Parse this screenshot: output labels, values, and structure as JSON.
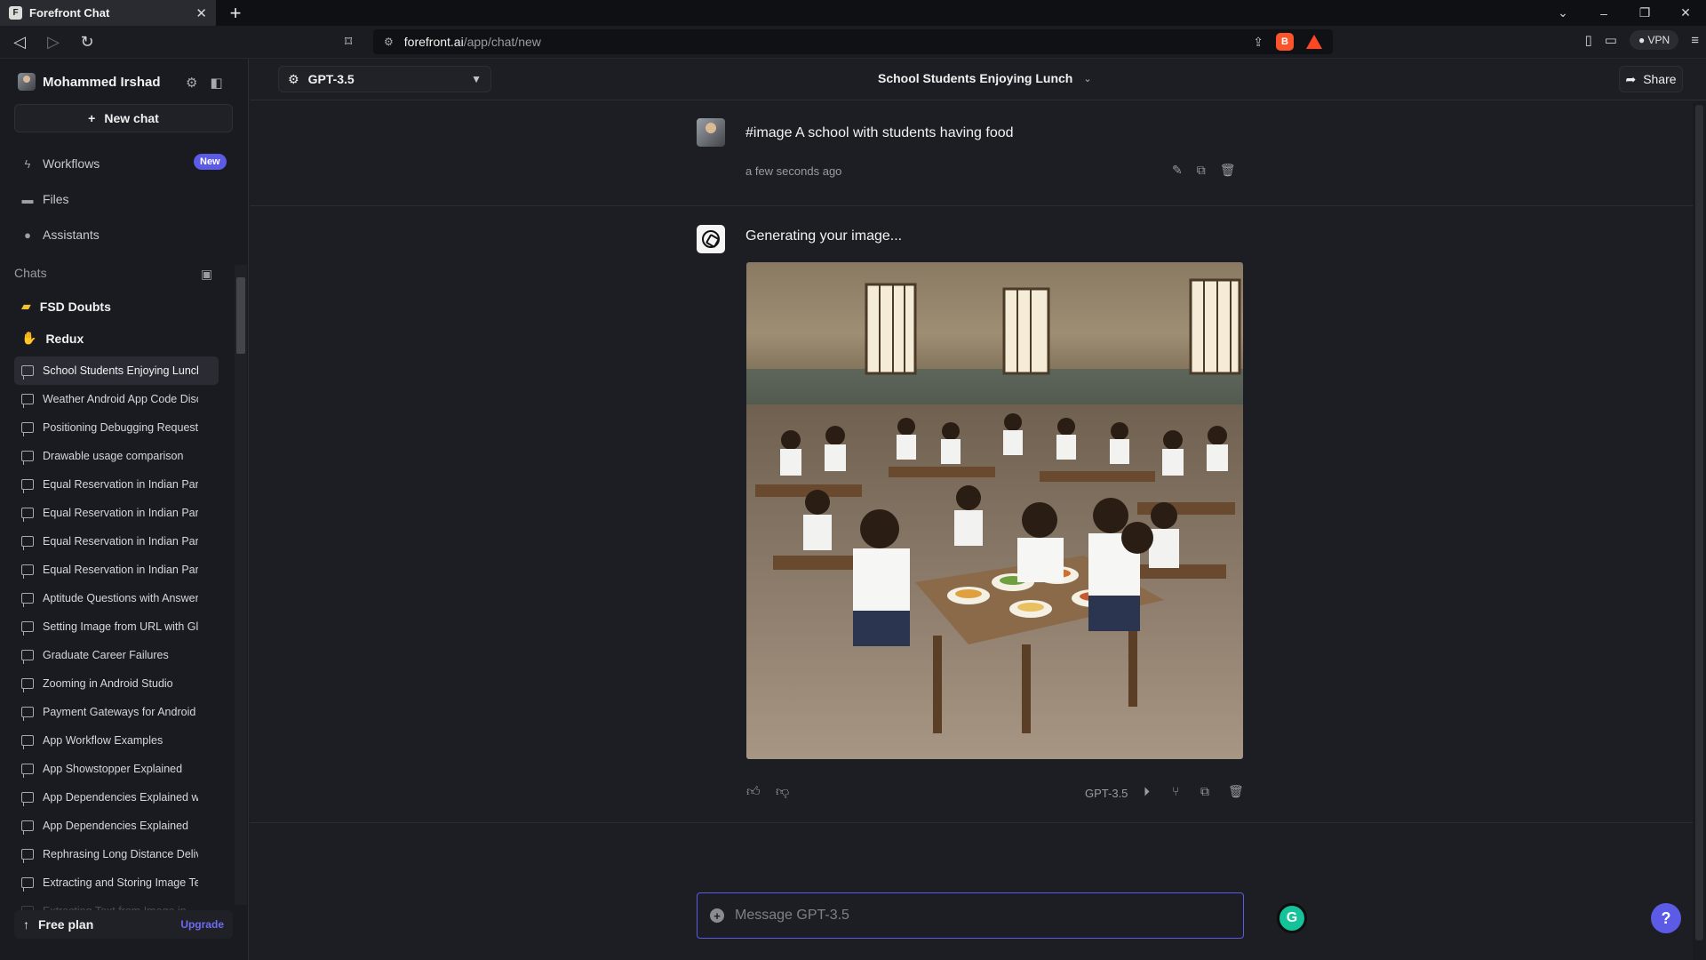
{
  "browser": {
    "tab_title": "Forefront Chat",
    "url_host": "forefront.ai",
    "url_path": "/app/chat/new",
    "vpn_label": "VPN"
  },
  "sidebar": {
    "user_name": "Mohammed Irshad",
    "new_chat_label": "New chat",
    "nav": [
      {
        "label": "Workflows",
        "icon": "bolt-icon"
      },
      {
        "label": "Files",
        "icon": "folder-icon"
      },
      {
        "label": "Assistants",
        "icon": "assistant-icon"
      }
    ],
    "new_badge": "New",
    "chats_heading": "Chats",
    "folders": [
      {
        "label": "FSD Doubts",
        "icon": "folder-yellow-icon"
      },
      {
        "label": "Redux",
        "icon": "hand-icon"
      }
    ],
    "chats": [
      "School Students Enjoying Lunch",
      "Weather Android App Code Disc",
      "Positioning Debugging Request",
      "Drawable usage comparison",
      "Equal Reservation in Indian Parli",
      "Equal Reservation in Indian Parli",
      "Equal Reservation in Indian Parli",
      "Equal Reservation in Indian Parli",
      "Aptitude Questions with Answer",
      "Setting Image from URL with Gli",
      "Graduate Career Failures",
      "Zooming in Android Studio",
      "Payment Gateways for Android A",
      "App Workflow Examples",
      "App Showstopper Explained",
      "App Dependencies Explained wi",
      "App Dependencies Explained",
      "Rephrasing Long Distance Deliv",
      "Extracting and Storing Image Te",
      "Extracting Text from Image in"
    ],
    "active_chat_index": 0,
    "free_plan_label": "Free plan",
    "upgrade_label": "Upgrade"
  },
  "topbar": {
    "model": "GPT-3.5",
    "conversation_title": "School Students Enjoying Lunch",
    "share_label": "Share"
  },
  "messages": {
    "user_text": "#image A school with students having food",
    "user_time": "a few seconds ago",
    "bot_text": "Generating your image...",
    "bot_model": "GPT-3.5"
  },
  "composer": {
    "placeholder": "Message GPT-3.5"
  },
  "colors": {
    "accent": "#5b5be6",
    "background": "#1d1e24",
    "sidebar": "#1a1b20"
  }
}
